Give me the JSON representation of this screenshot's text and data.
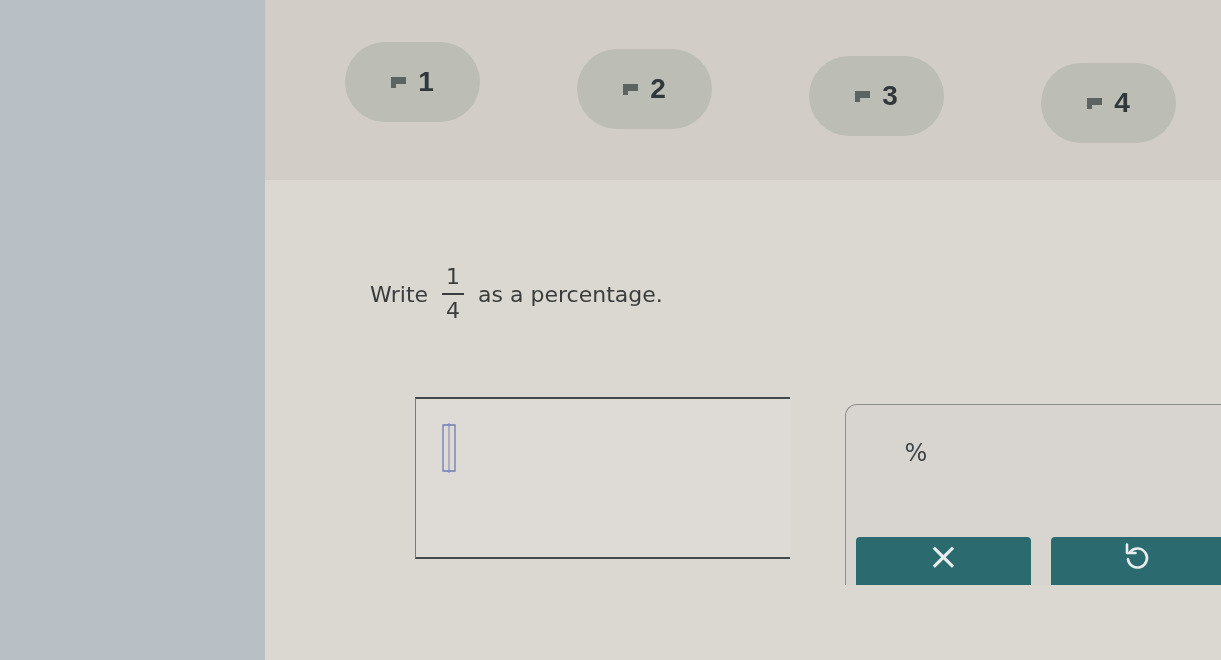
{
  "tabs": [
    {
      "label": "1",
      "selected": false
    },
    {
      "label": "2",
      "selected": false
    },
    {
      "label": "3",
      "selected": false
    },
    {
      "label": "4",
      "selected": false
    }
  ],
  "question": {
    "before": "Write",
    "fraction": {
      "numerator": "1",
      "denominator": "4"
    },
    "after": "as a percentage."
  },
  "keypad": {
    "keys": [
      {
        "label": "%"
      }
    ],
    "buttons": [
      {
        "kind": "clear",
        "label": "×"
      },
      {
        "kind": "undo"
      }
    ]
  }
}
